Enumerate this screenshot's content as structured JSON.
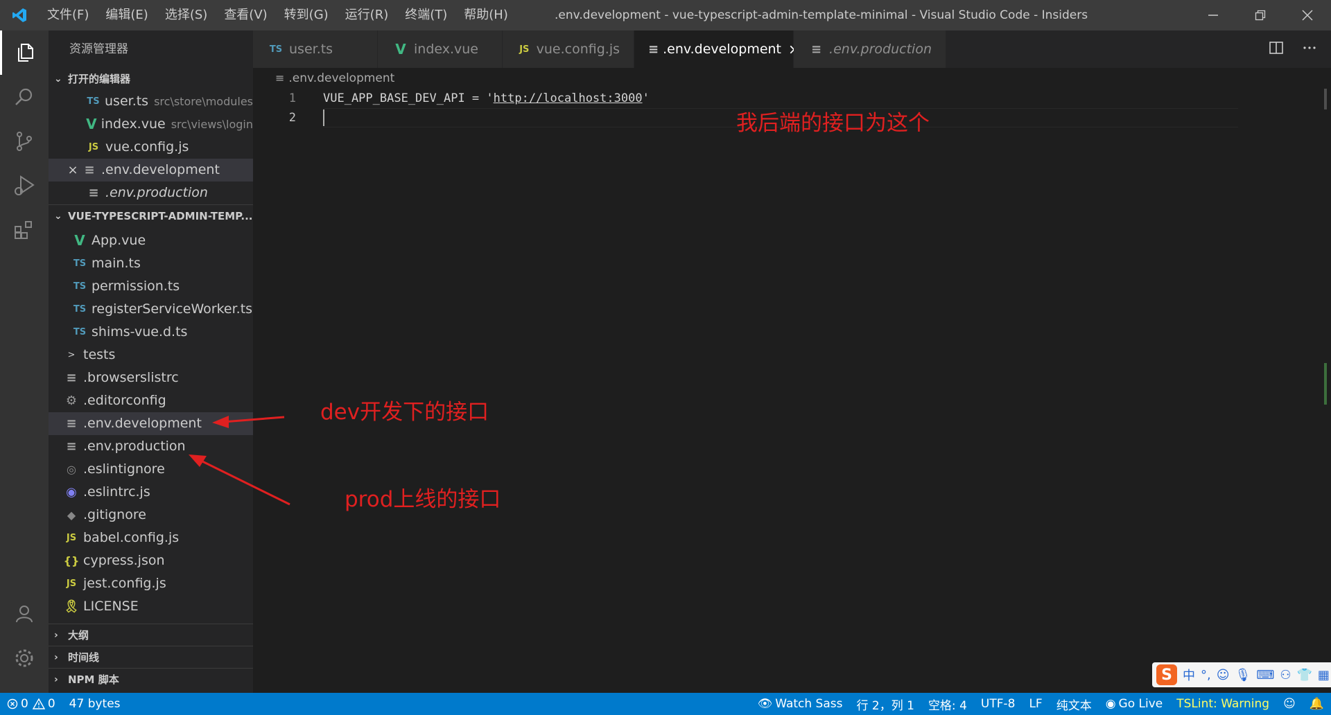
{
  "window": {
    "title": ".env.development - vue-typescript-admin-template-minimal - Visual Studio Code - Insiders",
    "menu": [
      "文件(F)",
      "编辑(E)",
      "选择(S)",
      "查看(V)",
      "转到(G)",
      "运行(R)",
      "终端(T)",
      "帮助(H)"
    ]
  },
  "sidebar": {
    "title": "资源管理器",
    "open_editors": {
      "header": "打开的编辑器",
      "items": [
        {
          "icon": "TS",
          "name": "user.ts",
          "desc": "src\\store\\modules"
        },
        {
          "icon": "V",
          "name": "index.vue",
          "desc": "src\\views\\login"
        },
        {
          "icon": "JS",
          "name": "vue.config.js",
          "desc": ""
        },
        {
          "icon": "≡",
          "name": ".env.development",
          "desc": ""
        },
        {
          "icon": "≡",
          "name": ".env.production",
          "desc": ""
        }
      ]
    },
    "project": {
      "header": "VUE-TYPESCRIPT-ADMIN-TEMP...",
      "items": [
        {
          "icon": "V",
          "name": "App.vue"
        },
        {
          "icon": "TS",
          "name": "main.ts"
        },
        {
          "icon": "TS",
          "name": "permission.ts"
        },
        {
          "icon": "TS",
          "name": "registerServiceWorker.ts"
        },
        {
          "icon": "TS",
          "name": "shims-vue.d.ts"
        },
        {
          "icon": ">",
          "name": "tests"
        },
        {
          "icon": "≡",
          "name": ".browserslistrc"
        },
        {
          "icon": "⚙",
          "name": ".editorconfig"
        },
        {
          "icon": "≡",
          "name": ".env.development"
        },
        {
          "icon": "≡",
          "name": ".env.production"
        },
        {
          "icon": "◎",
          "name": ".eslintignore"
        },
        {
          "icon": "◉",
          "name": ".eslintrc.js"
        },
        {
          "icon": "◆",
          "name": ".gitignore"
        },
        {
          "icon": "JS",
          "name": "babel.config.js"
        },
        {
          "icon": "{}",
          "name": "cypress.json"
        },
        {
          "icon": "JS",
          "name": "jest.config.js"
        },
        {
          "icon": "🎗",
          "name": "LICENSE"
        }
      ]
    },
    "bottom_sections": [
      "大纲",
      "时间线",
      "NPM 脚本"
    ]
  },
  "tabs": [
    {
      "icon": "TS",
      "label": "user.ts"
    },
    {
      "icon": "V",
      "label": "index.vue"
    },
    {
      "icon": "JS",
      "label": "vue.config.js"
    },
    {
      "icon": "≡",
      "label": ".env.development"
    },
    {
      "icon": "≡",
      "label": ".env.production"
    }
  ],
  "tab_close": "×",
  "breadcrumb": ".env.development",
  "editor": {
    "line_numbers": [
      "1",
      "2"
    ],
    "line1_key": "VUE_APP_BASE_DEV_API = '",
    "line1_url": "http://localhost:3000",
    "line1_end": "'"
  },
  "annotations": {
    "backend": "我后端的接口为这个",
    "dev": "dev开发下的接口",
    "prod": "prod上线的接口"
  },
  "statusbar": {
    "errors": "0",
    "warnings": "0",
    "size": "47 bytes",
    "watch_sass": "Watch Sass",
    "position": "行 2，列 1",
    "spaces": "空格: 4",
    "encoding": "UTF-8",
    "eol": "LF",
    "language": "纯文本",
    "go_live": "Go Live",
    "tslint": "TSLint: Warning"
  },
  "ime": {
    "logo": "S",
    "mode": "中"
  },
  "colors": {
    "accent": "#007acc",
    "annotation": "#e02020"
  }
}
